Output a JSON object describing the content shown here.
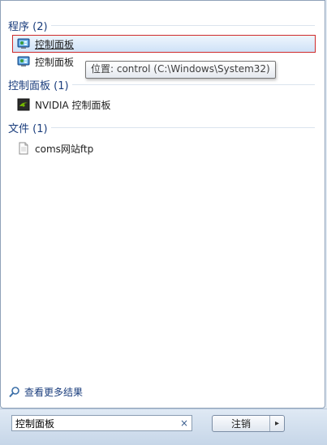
{
  "results": {
    "groups": [
      {
        "label": "程序 (2)"
      },
      {
        "label": "控制面板 (1)"
      },
      {
        "label": "文件 (1)"
      }
    ],
    "programs": [
      {
        "label": "控制面板",
        "icon": "control-panel-icon"
      },
      {
        "label": "控制面板",
        "icon": "control-panel-icon"
      }
    ],
    "control_panel_items": [
      {
        "label": "NVIDIA 控制面板",
        "icon": "nvidia-icon"
      }
    ],
    "files": [
      {
        "label": "coms网站ftp",
        "icon": "document-icon"
      }
    ]
  },
  "tooltip": {
    "text": "位置: control (C:\\Windows\\System32)"
  },
  "see_more": {
    "label": "查看更多结果",
    "icon": "search-icon"
  },
  "search": {
    "value": "控制面板",
    "clear_icon": "×"
  },
  "shutdown": {
    "label": "注销",
    "arrow": "▸"
  },
  "colors": {
    "selection_border": "#cf2a2a",
    "group_header": "#1a3d7c"
  }
}
